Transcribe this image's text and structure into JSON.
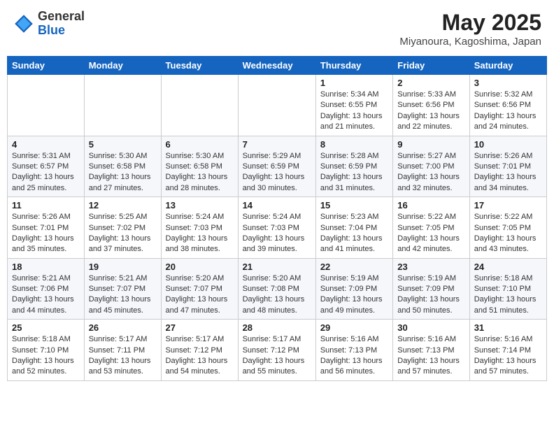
{
  "header": {
    "logo_general": "General",
    "logo_blue": "Blue",
    "month_year": "May 2025",
    "location": "Miyanoura, Kagoshima, Japan"
  },
  "weekdays": [
    "Sunday",
    "Monday",
    "Tuesday",
    "Wednesday",
    "Thursday",
    "Friday",
    "Saturday"
  ],
  "weeks": [
    [
      {
        "day": "",
        "info": ""
      },
      {
        "day": "",
        "info": ""
      },
      {
        "day": "",
        "info": ""
      },
      {
        "day": "",
        "info": ""
      },
      {
        "day": "1",
        "info": "Sunrise: 5:34 AM\nSunset: 6:55 PM\nDaylight: 13 hours\nand 21 minutes."
      },
      {
        "day": "2",
        "info": "Sunrise: 5:33 AM\nSunset: 6:56 PM\nDaylight: 13 hours\nand 22 minutes."
      },
      {
        "day": "3",
        "info": "Sunrise: 5:32 AM\nSunset: 6:56 PM\nDaylight: 13 hours\nand 24 minutes."
      }
    ],
    [
      {
        "day": "4",
        "info": "Sunrise: 5:31 AM\nSunset: 6:57 PM\nDaylight: 13 hours\nand 25 minutes."
      },
      {
        "day": "5",
        "info": "Sunrise: 5:30 AM\nSunset: 6:58 PM\nDaylight: 13 hours\nand 27 minutes."
      },
      {
        "day": "6",
        "info": "Sunrise: 5:30 AM\nSunset: 6:58 PM\nDaylight: 13 hours\nand 28 minutes."
      },
      {
        "day": "7",
        "info": "Sunrise: 5:29 AM\nSunset: 6:59 PM\nDaylight: 13 hours\nand 30 minutes."
      },
      {
        "day": "8",
        "info": "Sunrise: 5:28 AM\nSunset: 6:59 PM\nDaylight: 13 hours\nand 31 minutes."
      },
      {
        "day": "9",
        "info": "Sunrise: 5:27 AM\nSunset: 7:00 PM\nDaylight: 13 hours\nand 32 minutes."
      },
      {
        "day": "10",
        "info": "Sunrise: 5:26 AM\nSunset: 7:01 PM\nDaylight: 13 hours\nand 34 minutes."
      }
    ],
    [
      {
        "day": "11",
        "info": "Sunrise: 5:26 AM\nSunset: 7:01 PM\nDaylight: 13 hours\nand 35 minutes."
      },
      {
        "day": "12",
        "info": "Sunrise: 5:25 AM\nSunset: 7:02 PM\nDaylight: 13 hours\nand 37 minutes."
      },
      {
        "day": "13",
        "info": "Sunrise: 5:24 AM\nSunset: 7:03 PM\nDaylight: 13 hours\nand 38 minutes."
      },
      {
        "day": "14",
        "info": "Sunrise: 5:24 AM\nSunset: 7:03 PM\nDaylight: 13 hours\nand 39 minutes."
      },
      {
        "day": "15",
        "info": "Sunrise: 5:23 AM\nSunset: 7:04 PM\nDaylight: 13 hours\nand 41 minutes."
      },
      {
        "day": "16",
        "info": "Sunrise: 5:22 AM\nSunset: 7:05 PM\nDaylight: 13 hours\nand 42 minutes."
      },
      {
        "day": "17",
        "info": "Sunrise: 5:22 AM\nSunset: 7:05 PM\nDaylight: 13 hours\nand 43 minutes."
      }
    ],
    [
      {
        "day": "18",
        "info": "Sunrise: 5:21 AM\nSunset: 7:06 PM\nDaylight: 13 hours\nand 44 minutes."
      },
      {
        "day": "19",
        "info": "Sunrise: 5:21 AM\nSunset: 7:07 PM\nDaylight: 13 hours\nand 45 minutes."
      },
      {
        "day": "20",
        "info": "Sunrise: 5:20 AM\nSunset: 7:07 PM\nDaylight: 13 hours\nand 47 minutes."
      },
      {
        "day": "21",
        "info": "Sunrise: 5:20 AM\nSunset: 7:08 PM\nDaylight: 13 hours\nand 48 minutes."
      },
      {
        "day": "22",
        "info": "Sunrise: 5:19 AM\nSunset: 7:09 PM\nDaylight: 13 hours\nand 49 minutes."
      },
      {
        "day": "23",
        "info": "Sunrise: 5:19 AM\nSunset: 7:09 PM\nDaylight: 13 hours\nand 50 minutes."
      },
      {
        "day": "24",
        "info": "Sunrise: 5:18 AM\nSunset: 7:10 PM\nDaylight: 13 hours\nand 51 minutes."
      }
    ],
    [
      {
        "day": "25",
        "info": "Sunrise: 5:18 AM\nSunset: 7:10 PM\nDaylight: 13 hours\nand 52 minutes."
      },
      {
        "day": "26",
        "info": "Sunrise: 5:17 AM\nSunset: 7:11 PM\nDaylight: 13 hours\nand 53 minutes."
      },
      {
        "day": "27",
        "info": "Sunrise: 5:17 AM\nSunset: 7:12 PM\nDaylight: 13 hours\nand 54 minutes."
      },
      {
        "day": "28",
        "info": "Sunrise: 5:17 AM\nSunset: 7:12 PM\nDaylight: 13 hours\nand 55 minutes."
      },
      {
        "day": "29",
        "info": "Sunrise: 5:16 AM\nSunset: 7:13 PM\nDaylight: 13 hours\nand 56 minutes."
      },
      {
        "day": "30",
        "info": "Sunrise: 5:16 AM\nSunset: 7:13 PM\nDaylight: 13 hours\nand 57 minutes."
      },
      {
        "day": "31",
        "info": "Sunrise: 5:16 AM\nSunset: 7:14 PM\nDaylight: 13 hours\nand 57 minutes."
      }
    ]
  ]
}
